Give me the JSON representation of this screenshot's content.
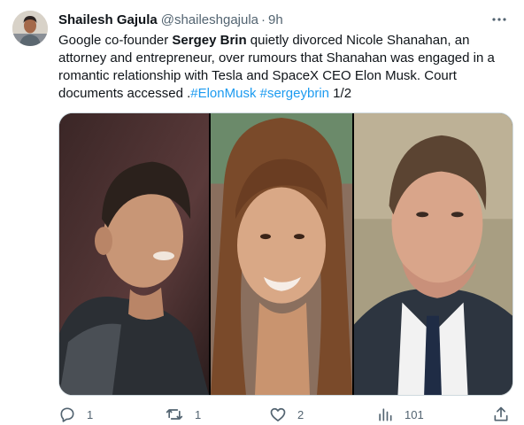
{
  "author": {
    "display_name": "Shailesh Gajula",
    "handle": "@shaileshgajula",
    "separator": "·",
    "time": "9h",
    "avatar_icon": "user-avatar"
  },
  "tweet": {
    "text_parts": [
      "Google co-founder ",
      "Sergey Brin",
      " quietly divorced Nicole Shanahan, an attorney and entrepreneur, over rumours that Shanahan was engaged in a romantic relationship with Tesla and SpaceX CEO Elon Musk. Court documents accessed .",
      "#ElonMusk",
      " ",
      "#sergeybrin",
      " 1/2"
    ]
  },
  "media": {
    "photos": [
      {
        "subject": "Sergey Brin",
        "icon": "photo"
      },
      {
        "subject": "Nicole Shanahan",
        "icon": "photo"
      },
      {
        "subject": "Elon Musk",
        "icon": "photo"
      }
    ]
  },
  "actions": {
    "reply": {
      "icon": "reply-icon",
      "count": "1"
    },
    "retweet": {
      "icon": "retweet-icon",
      "count": "1"
    },
    "like": {
      "icon": "like-icon",
      "count": "2"
    },
    "views": {
      "icon": "views-icon",
      "count": "101"
    },
    "share": {
      "icon": "share-icon"
    }
  },
  "colors": {
    "text": "#0f1419",
    "secondary": "#536471",
    "link": "#1d9bf0",
    "border": "#cfd9de"
  }
}
